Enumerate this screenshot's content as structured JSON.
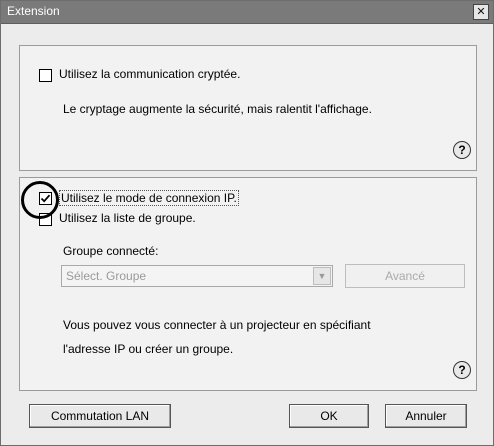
{
  "window": {
    "title": "Extension",
    "close_label": "✕"
  },
  "encryption": {
    "checkbox_label": "Utilisez la communication cryptée.",
    "checked": false,
    "description": "Le cryptage augmente la sécurité, mais ralentit l'affichage."
  },
  "ip_mode": {
    "checkbox_label": "Utilisez le mode de connexion IP.",
    "checked": true
  },
  "group_list": {
    "checkbox_label": "Utilisez la liste de groupe.",
    "checked": false,
    "connected_group_label": "Groupe connecté:",
    "combo_value": "Sélect. Groupe",
    "advanced_label": "Avancé",
    "description_line1": "Vous pouvez vous connecter à un projecteur en spécifiant",
    "description_line2": "l'adresse IP ou créer un groupe."
  },
  "help_label": "?",
  "buttons": {
    "lan_switch": "Commutation LAN",
    "ok": "OK",
    "cancel": "Annuler"
  }
}
